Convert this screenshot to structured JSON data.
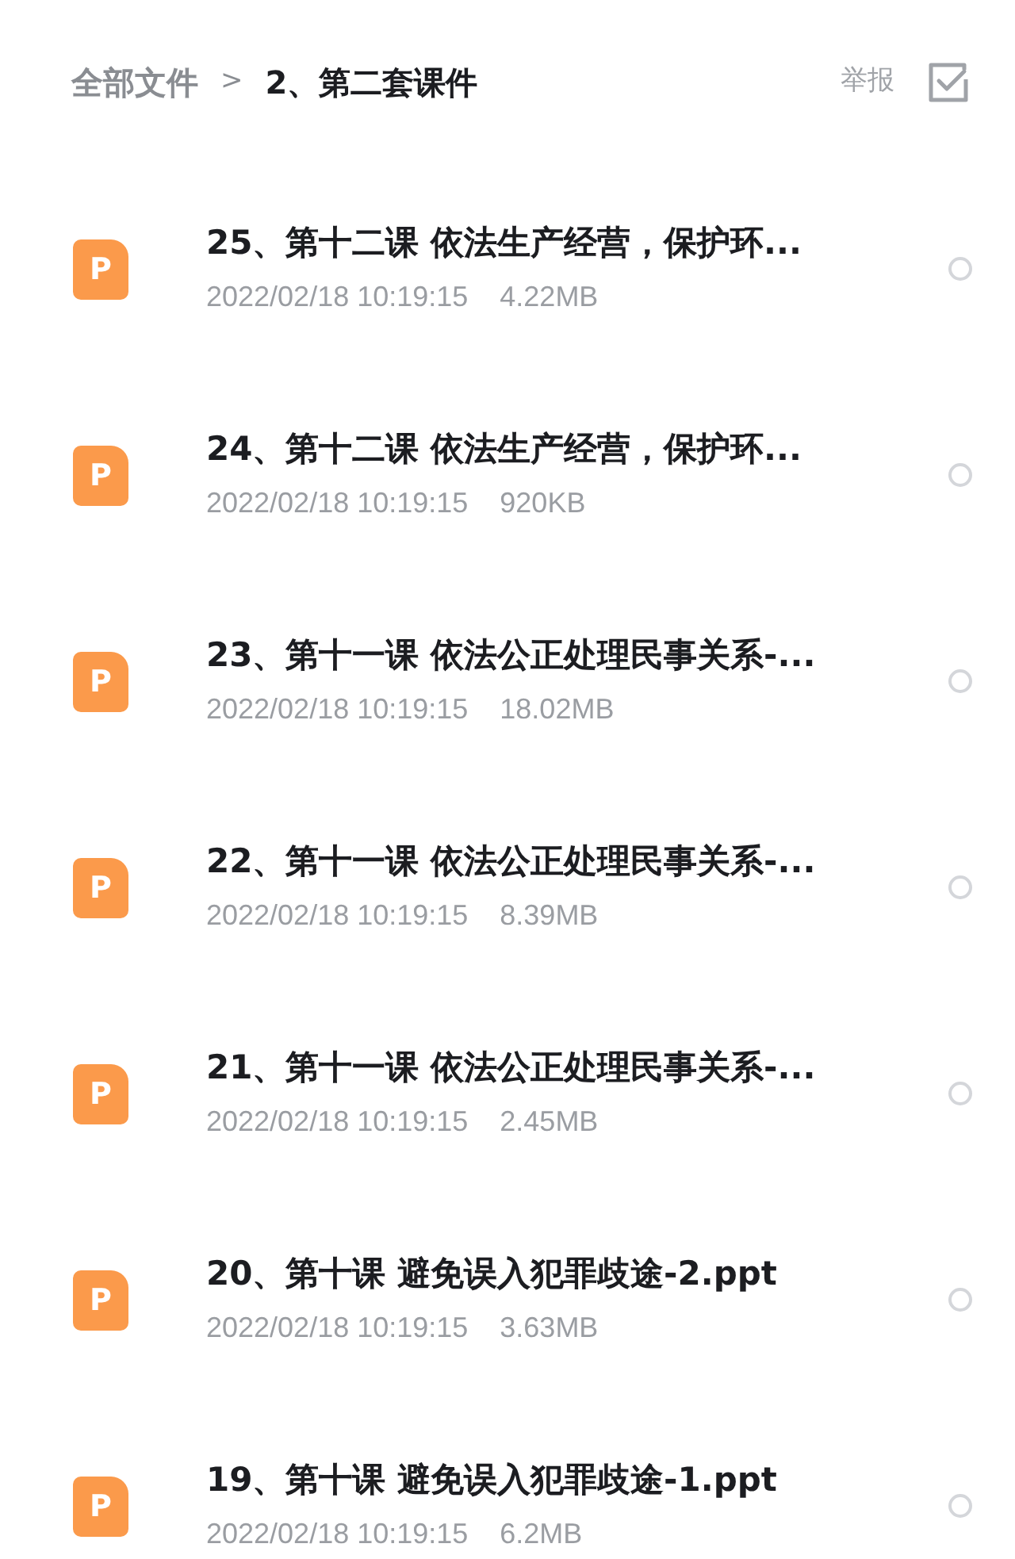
{
  "breadcrumb": [
    {
      "label": "全部文件",
      "current": false
    },
    {
      "label": "2、第二套课件",
      "current": true
    }
  ],
  "breadcrumb_separator": ">",
  "report_link": "举报",
  "files": [
    {
      "icon_letter": "P",
      "name": "25、第十二课 依法生产经营，保护环...",
      "date": "2022/02/18 10:19:15",
      "size": "4.22MB",
      "selected": false
    },
    {
      "icon_letter": "P",
      "name": "24、第十二课 依法生产经营，保护环...",
      "date": "2022/02/18 10:19:15",
      "size": "920KB",
      "selected": false
    },
    {
      "icon_letter": "P",
      "name": "23、第十一课 依法公正处理民事关系-...",
      "date": "2022/02/18 10:19:15",
      "size": "18.02MB",
      "selected": false
    },
    {
      "icon_letter": "P",
      "name": "22、第十一课 依法公正处理民事关系-...",
      "date": "2022/02/18 10:19:15",
      "size": "8.39MB",
      "selected": false
    },
    {
      "icon_letter": "P",
      "name": "21、第十一课 依法公正处理民事关系-...",
      "date": "2022/02/18 10:19:15",
      "size": "2.45MB",
      "selected": false
    },
    {
      "icon_letter": "P",
      "name": "20、第十课 避免误入犯罪歧途-2.ppt",
      "date": "2022/02/18 10:19:15",
      "size": "3.63MB",
      "selected": false
    },
    {
      "icon_letter": "P",
      "name": "19、第十课 避免误入犯罪歧途-1.ppt",
      "date": "2022/02/18 10:19:15",
      "size": "6.2MB",
      "selected": false
    }
  ]
}
